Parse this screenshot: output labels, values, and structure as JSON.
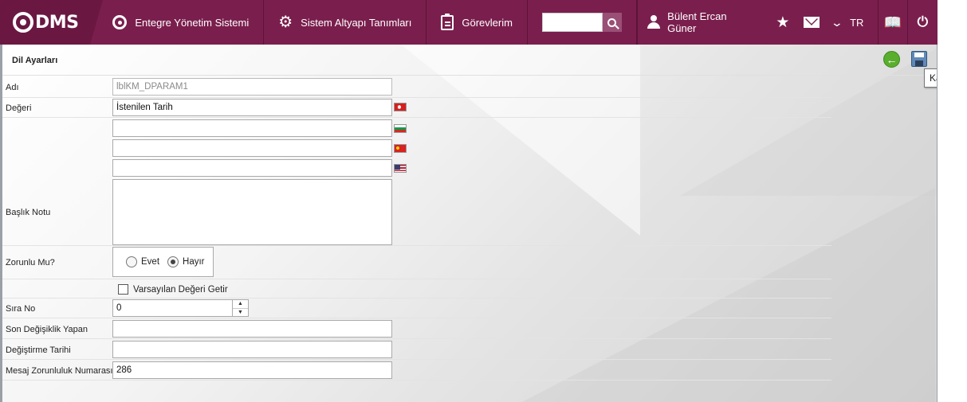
{
  "app": {
    "logo_text": "DMS",
    "nav": {
      "integrated_system": "Entegre Yönetim Sistemi",
      "infrastructure": "Sistem Altyapı Tanımları",
      "tasks": "Görevlerim"
    },
    "search": {
      "value": "",
      "placeholder": ""
    },
    "user_name": "Bülent Ercan Güner",
    "language": "TR"
  },
  "page": {
    "title": "Dil Ayarları",
    "tooltip": "Kaydet"
  },
  "form": {
    "name_label": "Adı",
    "name_value": "lblKM_DPARAM1",
    "value_label": "Değeri",
    "value_tr": "İstenilen Tarih",
    "value_bg": "",
    "value_cn": "",
    "value_us": "",
    "note_label": "Başlık Notu",
    "note_value": "",
    "required_label": "Zorunlu Mu?",
    "required_yes": "Evet",
    "required_no": "Hayır",
    "required_selected": "Hayır",
    "default_value_label": "Varsayılan Değeri Getir",
    "order_label": "Sıra No",
    "order_value": "0",
    "last_modifier_label": "Son Değişiklik Yapan",
    "last_modifier_value": "",
    "modified_date_label": "Değiştirme Tarihi",
    "modified_date_value": "",
    "message_number_label": "Mesaj Zorunluluk Numarası",
    "message_number_value": "286"
  },
  "colors": {
    "topbar": "#7a1f4d",
    "logo_bg": "#6a1842",
    "back_button": "#5aae2e",
    "save_button": "#5f89b8"
  }
}
